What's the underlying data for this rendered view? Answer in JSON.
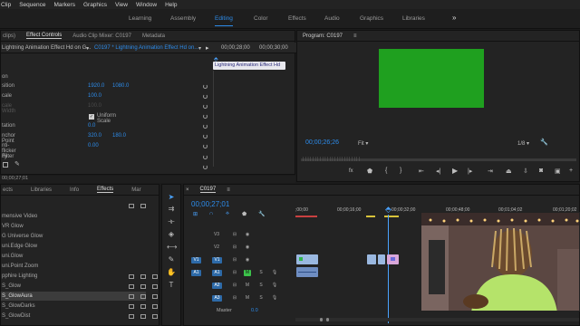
{
  "menubar": {
    "items": [
      "Clip",
      "Sequence",
      "Markers",
      "Graphics",
      "View",
      "Window",
      "Help"
    ]
  },
  "workspaces": {
    "tabs": [
      "Learning",
      "Assembly",
      "Editing",
      "Color",
      "Effects",
      "Audio",
      "Graphics",
      "Libraries"
    ],
    "active": "Editing",
    "more": "»"
  },
  "source_panel": {
    "tabs": [
      "clips)",
      "Effect Controls",
      "Audio Clip Mixer: C0197",
      "Metadata"
    ],
    "active_tab": "Effect Controls",
    "master_label": "Lightning Animation Effect Hd on G...",
    "clip_path": "C0197 * Lightning Animation Effect Hd on...",
    "mini_timecodes": [
      "00;00;28;00",
      "00;00;30;00"
    ],
    "clip_label": "Lightning Animation Effect Hd",
    "properties": [
      {
        "name": "on",
        "v1": "",
        "v2": ""
      },
      {
        "name": "sition",
        "v1": "1920.0",
        "v2": "1080.0"
      },
      {
        "name": "cale",
        "v1": "100.0",
        "v2": ""
      },
      {
        "name": "cale Width",
        "v1": "100.0",
        "v2": ""
      },
      {
        "name": "",
        "v1": "Uniform Scale",
        "v2": ""
      },
      {
        "name": "tation",
        "v1": "0.0",
        "v2": ""
      },
      {
        "name": "nchor Point",
        "v1": "320.0",
        "v2": "180.0"
      },
      {
        "name": "nti-flicker Filter",
        "v1": "0.00",
        "v2": ""
      },
      {
        "name": "ity",
        "v1": "",
        "v2": ""
      }
    ],
    "footer_timecode": "00;00;27;01"
  },
  "program_monitor": {
    "title": "Program: C0197",
    "timecode": "00;00;26;26",
    "fit": "Fit",
    "resolution": "1/8",
    "screen_color": "#1fa01f"
  },
  "effects_panel": {
    "tabs": [
      "ects",
      "Libraries",
      "Info",
      "Effects",
      "Mar"
    ],
    "active_tab": "Effects",
    "items": [
      "mensive Video",
      "VR Glow",
      "G Universe Glow",
      "uni.Edge Glow",
      "uni.Glow",
      "uni.Point Zoom",
      "pphire Lighting",
      "S_Glow",
      "S_GlowAura",
      "S_GlowDarks",
      "S_GlowDist"
    ],
    "selected": "S_GlowAura"
  },
  "timeline": {
    "sequence": "C0197",
    "timecode": "00;00;27;01",
    "ruler": [
      ";00;00",
      "00;00;16;00",
      "00;00;32;00",
      "00;00;48;00",
      "00;01;04;02",
      "00;01;20;02"
    ],
    "video_tracks": [
      "V3",
      "V2",
      "V1"
    ],
    "audio_tracks": [
      "A1",
      "A2",
      "A3"
    ],
    "source_v": "V1",
    "source_a": "A1",
    "master_label": "Master",
    "master_value": "0.0",
    "m_label": "M",
    "s_label": "S"
  },
  "webcam": {
    "description": "webcam overlay"
  },
  "colors": {
    "accent": "#2d8ceb",
    "clip_video": "#9ab8e0",
    "clip_audio": "#6f8ec2",
    "clip_pink": "#d9a6d9",
    "playhead": "#4aa3ff"
  }
}
